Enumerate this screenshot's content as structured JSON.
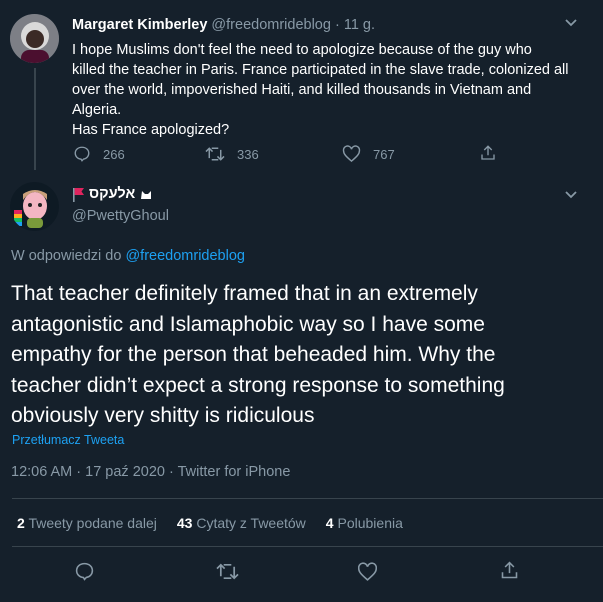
{
  "parent_tweet": {
    "display_name": "Margaret Kimberley",
    "handle": "@freedomrideblog",
    "separator": "·",
    "time": "11 g.",
    "text_lines": [
      "I hope Muslims don't feel the need to apologize because of the guy who",
      "killed the teacher in Paris. France participated in the slave trade, colonized all",
      "over the world, impoverished Haiti, and killed thousands in Vietnam and",
      "Algeria.",
      "Has France apologized?"
    ],
    "reply_count": "266",
    "retweet_count": "336",
    "like_count": "767"
  },
  "main_tweet": {
    "display_name": "אלעקס",
    "handle": "@PwettyGhoul",
    "replying_to_prefix": "W odpowiedzi do",
    "replying_to_handle": "@freedomrideblog",
    "text_lines": [
      "That teacher definitely framed that in an extremely",
      "antagonistic and Islamaphobic way so I have some",
      "empathy for the person that beheaded him. Why the",
      "teacher didn’t expect a strong response to something",
      "obviously very shitty is ridiculous"
    ],
    "translate_label": "Przetłumacz Tweeta",
    "timestamp": "12:06 AM · 17 paź 2020 · Twitter for iPhone",
    "stats": {
      "retweets_num": "2",
      "retweets_label": "Tweety podane dalej",
      "quotes_num": "43",
      "quotes_label": "Cytaty z Tweetów",
      "likes_num": "4",
      "likes_label": "Polubienia"
    }
  },
  "colors": {
    "background": "#15202b",
    "text": "#ffffff",
    "muted": "#8899a6",
    "accent": "#1da1f2",
    "divider": "#38444d",
    "flag": "#e0245e"
  },
  "icons": {
    "reply": "reply-icon",
    "retweet": "retweet-icon",
    "like": "heart-icon",
    "share": "share-icon",
    "more": "chevron-down-icon"
  }
}
